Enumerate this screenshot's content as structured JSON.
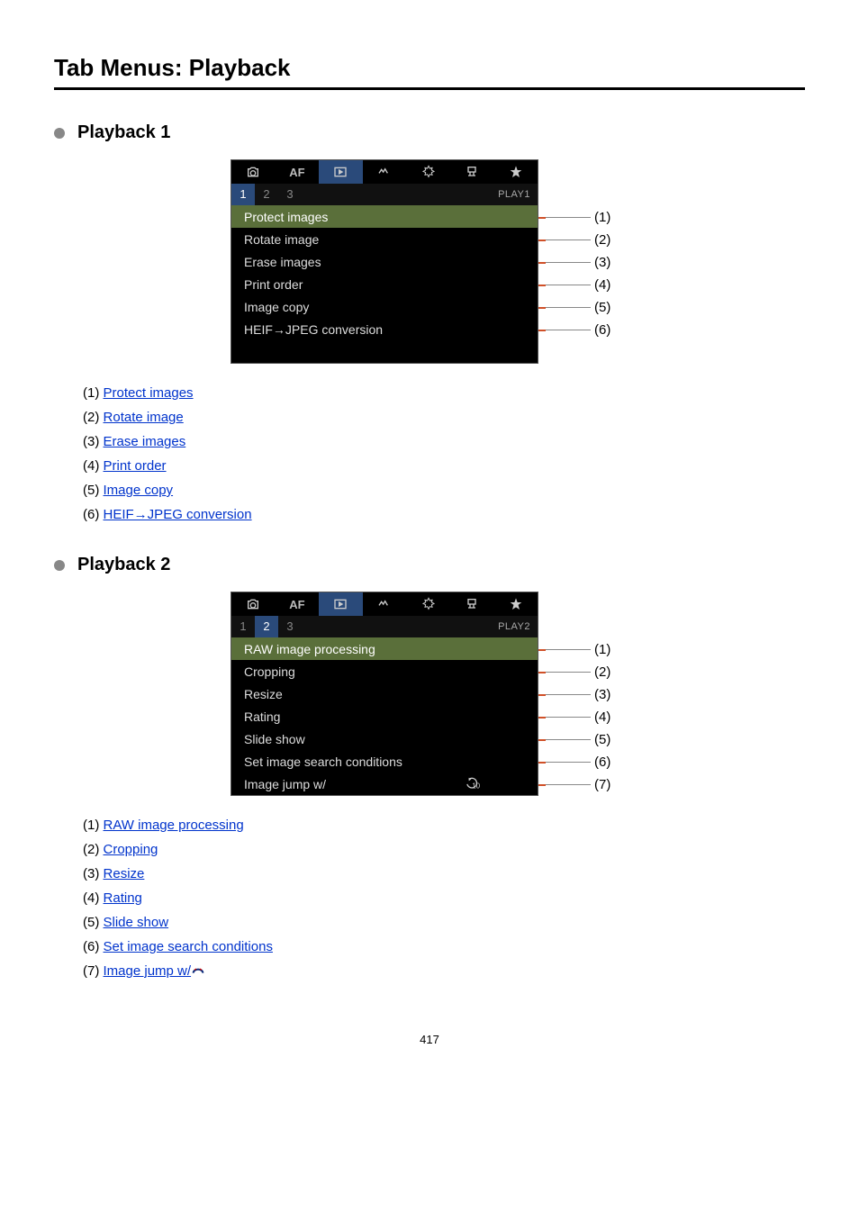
{
  "page_title": "Tab Menus: Playback",
  "page_number": "417",
  "sections": [
    {
      "heading": "Playback 1",
      "screen": {
        "page_label": "PLAY1",
        "active_page": 1,
        "pages": [
          "1",
          "2",
          "3"
        ],
        "active_top_tab": 2,
        "selected_item": 0,
        "items": [
          {
            "label": "Protect images"
          },
          {
            "label": "Rotate image"
          },
          {
            "label": "Erase images"
          },
          {
            "label": "Print order"
          },
          {
            "label": "Image copy"
          },
          {
            "label": "HEIF→JPEG conversion"
          }
        ]
      },
      "links": [
        {
          "num": "(1)",
          "text": "Protect images"
        },
        {
          "num": "(2)",
          "text": "Rotate image"
        },
        {
          "num": "(3)",
          "text": "Erase images"
        },
        {
          "num": "(4)",
          "text": "Print order"
        },
        {
          "num": "(5)",
          "text": "Image copy"
        },
        {
          "num": "(6)",
          "text": "HEIF→JPEG conversion"
        }
      ]
    },
    {
      "heading": "Playback 2",
      "screen": {
        "page_label": "PLAY2",
        "active_page": 2,
        "pages": [
          "1",
          "2",
          "3"
        ],
        "active_top_tab": 2,
        "selected_item": 0,
        "items": [
          {
            "label": "RAW image processing"
          },
          {
            "label": "Cropping"
          },
          {
            "label": "Resize"
          },
          {
            "label": "Rating"
          },
          {
            "label": "Slide show"
          },
          {
            "label": "Set image search conditions"
          },
          {
            "label": "Image jump w/",
            "has_dial_icon": true,
            "value_icon": "jump10"
          }
        ]
      },
      "links": [
        {
          "num": "(1)",
          "text": "RAW image processing"
        },
        {
          "num": "(2)",
          "text": "Cropping"
        },
        {
          "num": "(3)",
          "text": "Resize"
        },
        {
          "num": "(4)",
          "text": "Rating"
        },
        {
          "num": "(5)",
          "text": "Slide show"
        },
        {
          "num": "(6)",
          "text": "Set image search conditions"
        },
        {
          "num": "(7)",
          "text": "Image jump w/",
          "has_dial_icon": true
        }
      ]
    }
  ],
  "top_tab_icons": [
    "camera",
    "AF",
    "playback",
    "wireless",
    "setup",
    "custom",
    "star"
  ]
}
